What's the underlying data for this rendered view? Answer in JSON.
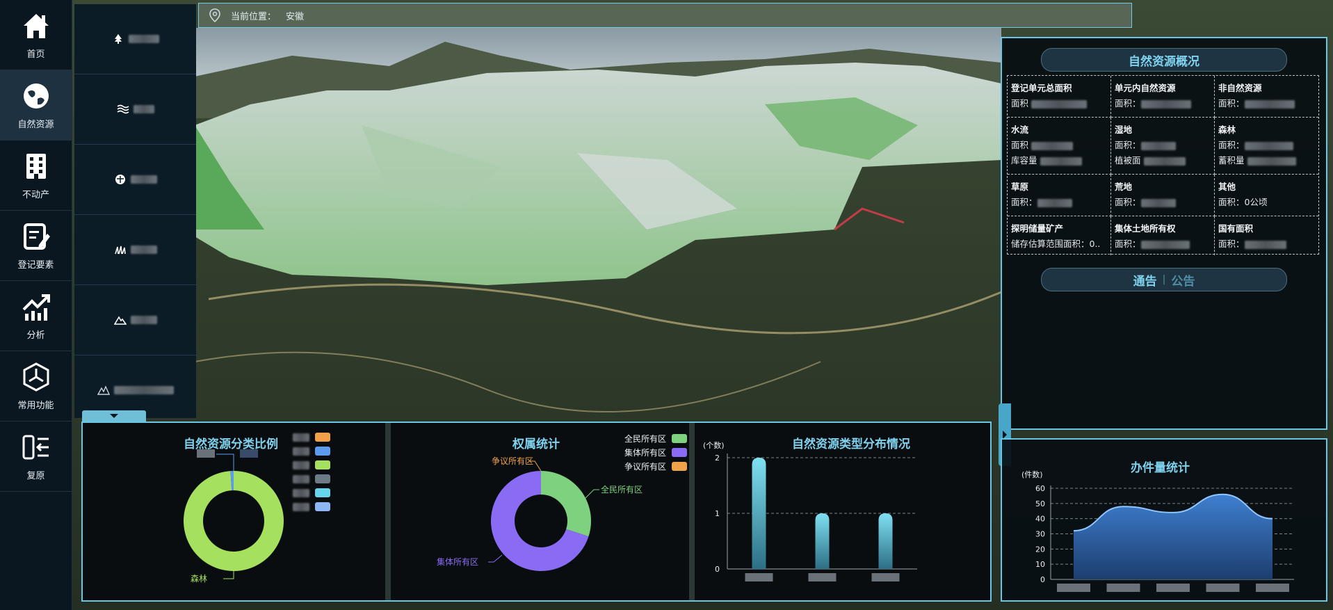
{
  "nav": {
    "items": [
      {
        "label": "首页",
        "icon": "home-icon"
      },
      {
        "label": "自然资源",
        "icon": "globe-icon",
        "active": true
      },
      {
        "label": "不动产",
        "icon": "building-icon"
      },
      {
        "label": "登记要素",
        "icon": "edit-doc-icon"
      },
      {
        "label": "分析",
        "icon": "chart-trend-icon"
      },
      {
        "label": "常用功能",
        "icon": "hexagon-icon"
      },
      {
        "label": "复原",
        "icon": "restore-icon"
      }
    ]
  },
  "subnav": {
    "items": [
      {
        "icon": "tree-icon"
      },
      {
        "icon": "water-icon"
      },
      {
        "icon": "globe-small-icon"
      },
      {
        "icon": "grass-icon"
      },
      {
        "icon": "mountain-icon"
      },
      {
        "icon": "mineral-icon"
      }
    ]
  },
  "breadcrumb": {
    "label": "当前位置：",
    "value": "安徽"
  },
  "overview": {
    "title": "自然资源概况",
    "cells": [
      {
        "heading": "登记单元总面积",
        "rows": [
          "面积"
        ]
      },
      {
        "heading": "单元内自然资源",
        "rows": [
          "面积："
        ]
      },
      {
        "heading": "非自然资源",
        "rows": [
          "面积："
        ]
      },
      {
        "heading": "水流",
        "rows": [
          "面积",
          "库容量"
        ]
      },
      {
        "heading": "湿地",
        "rows": [
          "面积：",
          "植被面"
        ]
      },
      {
        "heading": "森林",
        "rows": [
          "面积：",
          "蓄积量"
        ]
      },
      {
        "heading": "草原",
        "rows": [
          "面积："
        ]
      },
      {
        "heading": "荒地",
        "rows": [
          "面积："
        ]
      },
      {
        "heading": "其他",
        "rows": [
          "面积：0公顷"
        ]
      },
      {
        "heading": "探明储量矿产",
        "rows": [
          "储存估算范围面积：0.."
        ]
      },
      {
        "heading": "集体土地所有权",
        "rows": [
          "面积："
        ]
      },
      {
        "heading": "国有面积",
        "rows": [
          "面积："
        ]
      }
    ],
    "tabs": [
      {
        "label": "通告",
        "active": true
      },
      {
        "label": "公告",
        "active": false
      }
    ],
    "tab_separator": "|"
  },
  "colors": {
    "accent": "#7fd3ef",
    "border": "#68c7e4",
    "green": "#a6e05f",
    "purple": "#8a6cf4",
    "orange": "#f0a24a"
  },
  "chart_data": [
    {
      "type": "pie",
      "title": "自然资源分类比例",
      "legend_colors": [
        "#f0a24a",
        "#5b9cf0",
        "#a6e05f",
        "#6b7a86",
        "#66d4ea",
        "#8eb6f5"
      ],
      "slices": [
        {
          "value": 99,
          "color": "#a6e05f"
        },
        {
          "value": 1,
          "color": "#5b9cf0"
        }
      ],
      "label_bottom": "森林"
    },
    {
      "type": "pie",
      "title": "权属统计",
      "legend": [
        {
          "name": "全民所有区",
          "color": "#7ed17e"
        },
        {
          "name": "集体所有区",
          "color": "#8a6cf4"
        },
        {
          "name": "争议所有区",
          "color": "#f0a24a"
        }
      ],
      "slices": [
        {
          "name": "全民所有区",
          "value": 30,
          "color": "#7ed17e"
        },
        {
          "name": "集体所有区",
          "value": 70,
          "color": "#8a6cf4"
        },
        {
          "name": "争议所有区",
          "value": 0,
          "color": "#f0a24a"
        }
      ]
    },
    {
      "type": "bar",
      "title": "自然资源类型分布情况",
      "ylabel": "(个数)",
      "ylim": [
        0,
        2
      ],
      "yticks": [
        "0",
        "1",
        "2"
      ],
      "values": [
        2,
        1,
        1
      ],
      "grid": true
    },
    {
      "type": "area",
      "title": "办件量统计",
      "ylabel": "(件数)",
      "ylim": [
        0,
        60
      ],
      "yticks": [
        "0",
        "10",
        "20",
        "30",
        "40",
        "50",
        "60"
      ],
      "values": [
        32,
        48,
        44,
        56,
        40
      ],
      "grid": true
    }
  ]
}
